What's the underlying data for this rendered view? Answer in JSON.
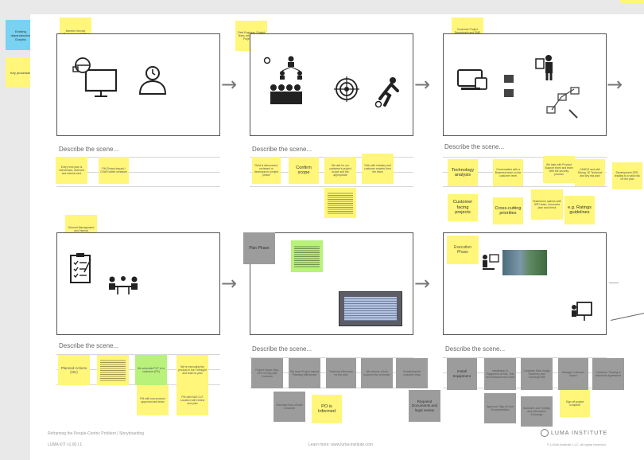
{
  "side_notes": [
    {
      "id": "side-1",
      "text": "Existing dependencies Graphic",
      "color": "blue"
    },
    {
      "id": "side-2",
      "text": "Key processes",
      "color": "yellow"
    }
  ],
  "describe_label": "Describe the scene...",
  "scenes": [
    {
      "id": "s1",
      "header": "Member Service Technician or CSRs"
    },
    {
      "id": "s2",
      "header": "Field Engineer, Project Team, and Leadership Project Board"
    },
    {
      "id": "s3",
      "header": "Customer Project Department and SME Analyst team"
    },
    {
      "id": "s4",
      "header": "General Management and Internal Reconstruction"
    },
    {
      "id": "s5",
      "header": "Plan Phase"
    },
    {
      "id": "s6",
      "header": "Execution Phase"
    }
  ],
  "notes": {
    "n1a": "Every new plan is interviewed, deferred and referral sent",
    "n1b": "PM Shows Impact / CSAR within schedule",
    "n2a": "Field is discovered, reviewed or developed in project phase",
    "n2b": "Confirm scope",
    "n2c": "We ask for our customer's project scope and the appropriate",
    "n2d": "Role with industry and customer experts from the team",
    "n3a": "Technology analysis",
    "n3b": "Conversation with a Business team on the customer level",
    "n3c": "We take with Product Support team and team with the security process",
    "n3d": "CANDO and with Strong, 30 Technical and key risk plan",
    "n3e": "Development SPD, leading to a valid risk for the plan",
    "n3f": "Customer facing projects",
    "n3g": "Cross-cutting priorities",
    "n3h": "Brainstorm options with SPD team, resources plan and check",
    "n3i": "e.g. Ratings guidelines",
    "n4a": "Planned Actions (OK)",
    "n4c": "We schedule PVT in to customer (PS)",
    "n4d": "We're executing the product in the Foresight and team to plan",
    "n4e": "PM with new product approved and team",
    "n4f": "PM with NAS CJT Location with review and plan",
    "n5a": "Project Scope Map, 25% of Gap with Customer",
    "n5b": "We have Project Impact Planning Milestones",
    "n5c": "Technical Discovery for the plan",
    "n5d": "We reserve a final scope in the customer",
    "n5e": "Scheduling the customer map",
    "n5f": "Schedule Kick-off with Customer",
    "n5g": "PO is Informed",
    "n5h": "Required Documents and legal review",
    "n6a": "Install Equipment",
    "n6b": "Installation of Equipment at Site, Test and Measurement Data",
    "n6c": "Complete Data Usage Summary and Exchange Bill",
    "n6d": "Manage Customer Issues",
    "n6e": "Customer Training & Handover Agreement",
    "n6f": "Approval, Sign-off and Documentation",
    "n6g": "Handover and Training and Information Exchange",
    "n6h": "Sign off project complete"
  },
  "footer": {
    "left": "Reframing the People-Centric Problem | Storyboarding",
    "left_sub": "LUMA KIT v1.00 | 1",
    "center": "Learn more: www.luma-institute.com",
    "logo": "LUMA INSTITUTE",
    "right": "© LUMA Institute, LLC. All rights reserved."
  },
  "icons": [
    "technician-computer-icon",
    "support-agent-icon",
    "team-hierarchy-icon",
    "target-icon",
    "soccer-player-icon",
    "devices-icon",
    "presenter-icon",
    "checklist-clipboard-icon",
    "meeting-table-icon",
    "presentation-board-icon"
  ]
}
